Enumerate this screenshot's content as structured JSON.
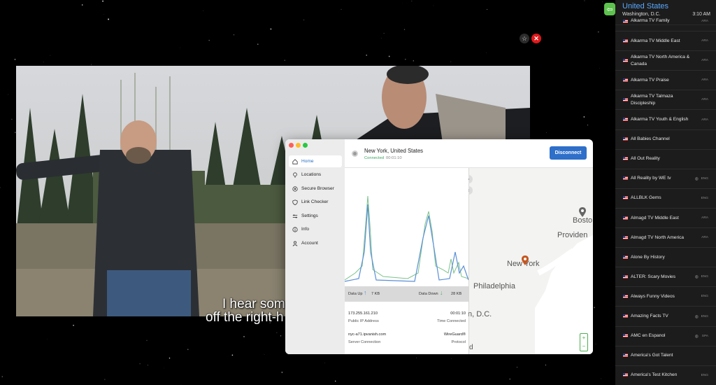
{
  "video": {
    "subtitle_line1": "I hear som",
    "subtitle_line2": "off the right-h"
  },
  "video_controls": {
    "star_icon": "star-outline-icon",
    "close_icon": "close-icon"
  },
  "vpn": {
    "nav": [
      {
        "label": "Home",
        "icon": "home-icon",
        "active": true
      },
      {
        "label": "Locations",
        "icon": "location-pin-icon",
        "active": false
      },
      {
        "label": "Secure Browser",
        "icon": "browser-icon",
        "active": false
      },
      {
        "label": "Link Checker",
        "icon": "shield-icon",
        "active": false
      },
      {
        "label": "Settings",
        "icon": "sliders-icon",
        "active": false
      },
      {
        "label": "Info",
        "icon": "info-icon",
        "active": false
      },
      {
        "label": "Account",
        "icon": "person-icon",
        "active": false
      }
    ],
    "location": "New York, United States",
    "status": "Connected",
    "status_timer": "00:01:10",
    "disconnect_label": "Disconnect",
    "data_up_label": "Data Up",
    "data_up_value": "7 KB",
    "data_down_label": "Data Down",
    "data_down_value": "28 KB",
    "public_ip": "173.255.161.210",
    "public_ip_label": "Public IP Address",
    "time_connected": "00:01:10",
    "time_connected_label": "Time Connected",
    "server": "nyc-a71.ipvanish.com",
    "server_label": "Server Connection",
    "protocol": "WireGuard®",
    "protocol_label": "Protocol",
    "map_labels": {
      "boston": "Bosto",
      "providence": "Providen",
      "new_york": "New York",
      "philadelphia": "Philadelphia",
      "dc": "n, D.C.",
      "bottom": "d"
    },
    "colors": {
      "accent": "#2e6fc9",
      "connected": "#3ba55c",
      "upload": "#5b8fd6",
      "download": "#7cc28a"
    }
  },
  "panel": {
    "country": "United States",
    "city": "Washington, D.C.",
    "time": "3:10 AM",
    "channels": [
      {
        "name": "Alkarma TV Family",
        "lang": "ARA",
        "globe": false
      },
      {
        "name": "Alkarma TV Middle East",
        "lang": "ARA",
        "globe": false
      },
      {
        "name": "Alkarma TV North America & Canada",
        "lang": "ARA",
        "globe": false
      },
      {
        "name": "Alkarma TV Praise",
        "lang": "ARA",
        "globe": false
      },
      {
        "name": "Alkarma TV Talmaza Discipleship",
        "lang": "ARA",
        "globe": false
      },
      {
        "name": "Alkarma TV Youth & English",
        "lang": "ARA",
        "globe": false
      },
      {
        "name": "All Babies Channel",
        "lang": "",
        "globe": false
      },
      {
        "name": "All Out Reality",
        "lang": "",
        "globe": false
      },
      {
        "name": "All Reality by WE tv",
        "lang": "ENG",
        "globe": true
      },
      {
        "name": "ALLBLK Gems",
        "lang": "ENG",
        "globe": false
      },
      {
        "name": "Almagd TV Middle East",
        "lang": "ARA",
        "globe": false
      },
      {
        "name": "Almagd TV North America",
        "lang": "ARA",
        "globe": false
      },
      {
        "name": "Alone By History",
        "lang": "",
        "globe": false
      },
      {
        "name": "ALTER: Scary Movies",
        "lang": "ENG",
        "globe": true
      },
      {
        "name": "Always Funny Videos",
        "lang": "ENG",
        "globe": false
      },
      {
        "name": "Amazing Facts TV",
        "lang": "ENG",
        "globe": true
      },
      {
        "name": "AMC en Espanol",
        "lang": "SPA",
        "globe": true
      },
      {
        "name": "America's Got Talent",
        "lang": "",
        "globe": false
      },
      {
        "name": "America's Test Kitchen",
        "lang": "ENG",
        "globe": false
      }
    ]
  }
}
